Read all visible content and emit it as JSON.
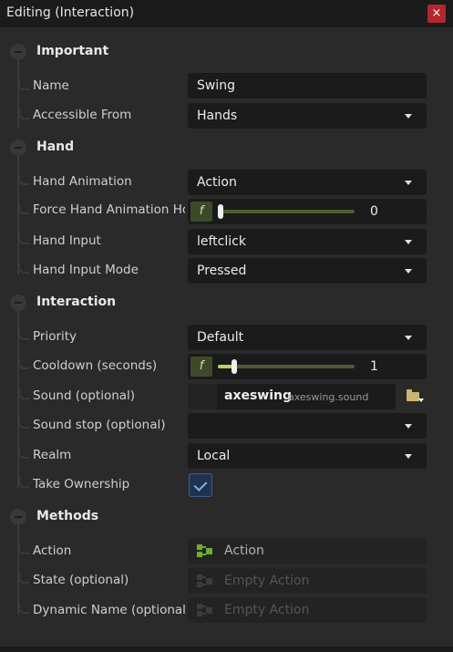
{
  "window": {
    "title": "Editing  (Interaction)",
    "close_label": "×"
  },
  "sections": {
    "important": {
      "label": "Important"
    },
    "hand": {
      "label": "Hand"
    },
    "interaction": {
      "label": "Interaction"
    },
    "methods": {
      "label": "Methods"
    }
  },
  "props": {
    "name": {
      "label": "Name",
      "value": "Swing"
    },
    "accessible_from": {
      "label": "Accessible From",
      "value": "Hands"
    },
    "hand_animation": {
      "label": "Hand Animation",
      "value": "Action"
    },
    "force_hand_animation": {
      "label": "Force Hand Animation Hold",
      "badge": "f",
      "value": "0",
      "slider_fraction": 0.0
    },
    "hand_input": {
      "label": "Hand Input",
      "value": "leftclick"
    },
    "hand_input_mode": {
      "label": "Hand Input Mode",
      "value": "Pressed"
    },
    "priority": {
      "label": "Priority",
      "value": "Default"
    },
    "cooldown": {
      "label": "Cooldown (seconds)",
      "badge": "f",
      "value": "1",
      "slider_fraction": 0.1
    },
    "sound": {
      "label": "Sound (optional)",
      "name": "axeswing",
      "file": "axeswing.sound"
    },
    "sound_stop": {
      "label": "Sound stop (optional)",
      "value": ""
    },
    "realm": {
      "label": "Realm",
      "value": "Local"
    },
    "take_ownership": {
      "label": "Take Ownership",
      "checked": true
    },
    "action": {
      "label": "Action",
      "value": "Action"
    },
    "state": {
      "label": "State (optional)",
      "value": "Empty Action"
    },
    "dynamic_name": {
      "label": "Dynamic Name (optional)",
      "value": "Empty Action"
    }
  },
  "colors": {
    "background": "#2a2a2a",
    "field": "#1b1b1b",
    "close": "#b3262d",
    "slider_accent": "#b8d06a",
    "checkbox": "#1f3350",
    "action_icon": "#6fae2f",
    "folder_icon": "#cbb56d"
  }
}
